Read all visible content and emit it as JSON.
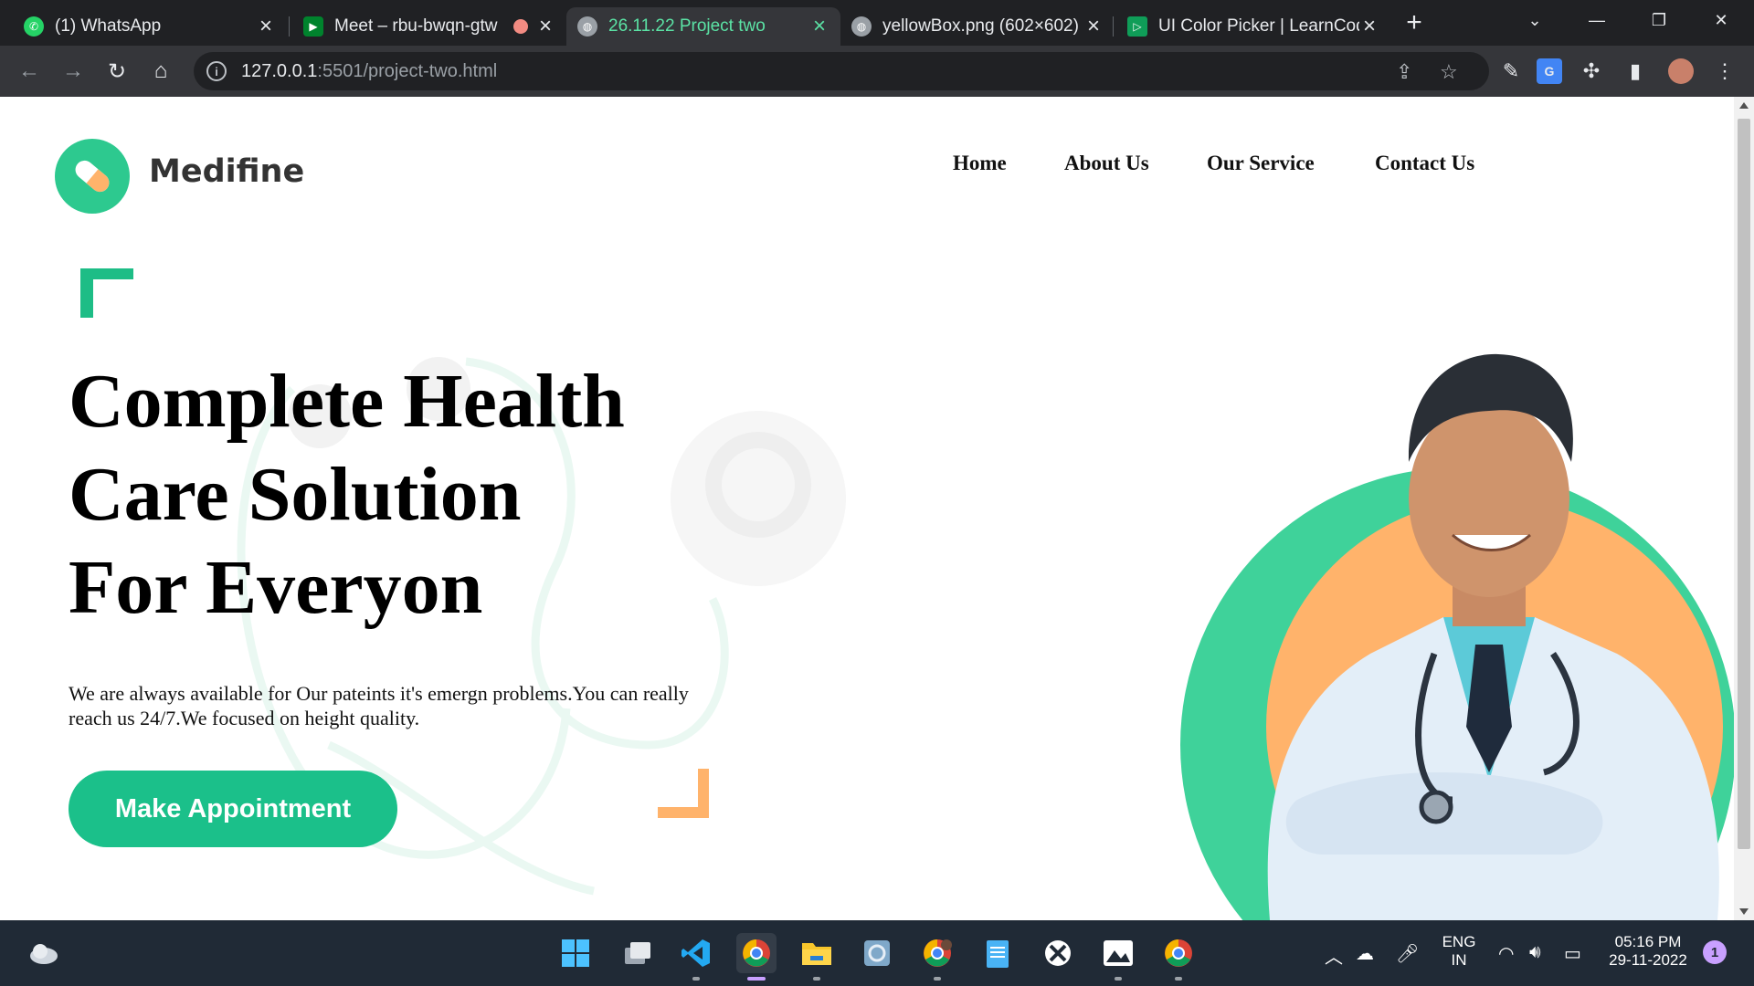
{
  "browser": {
    "tabs": [
      {
        "title": "(1) WhatsApp",
        "icon": "whatsapp-icon",
        "active": false
      },
      {
        "title": "Meet – rbu-bwqn-gtw",
        "icon": "google-meet-icon",
        "active": false
      },
      {
        "title": "26.11.22 Project two",
        "icon": "globe-icon",
        "active": true
      },
      {
        "title": "yellowBox.png (602×602)",
        "icon": "globe-icon",
        "active": false
      },
      {
        "title": "UI Color Picker | LearnCod",
        "icon": "learncode-icon",
        "active": false
      }
    ],
    "url_host": "127.0.0.1",
    "url_path": ":5501/project-two.html"
  },
  "site": {
    "logo_name": "Medifine",
    "nav": [
      "Home",
      "About Us",
      "Our Service",
      "Contact Us"
    ],
    "hero_title_lines": [
      "Complete Health",
      "Care Solution",
      "For Everyon"
    ],
    "hero_text": "We are always available for Our pateints it's emergn problems.You can really reach us 24/7.We focused on height quality.",
    "cta_label": "Make Appointment"
  },
  "colors": {
    "brand_green": "#1bc08a",
    "accent_orange": "#ffb36b",
    "active_tab_text": "#5be3a5"
  },
  "taskbar": {
    "lang_top": "ENG",
    "lang_bottom": "IN",
    "time": "05:16 PM",
    "date": "29-11-2022",
    "notification_count": "1"
  }
}
